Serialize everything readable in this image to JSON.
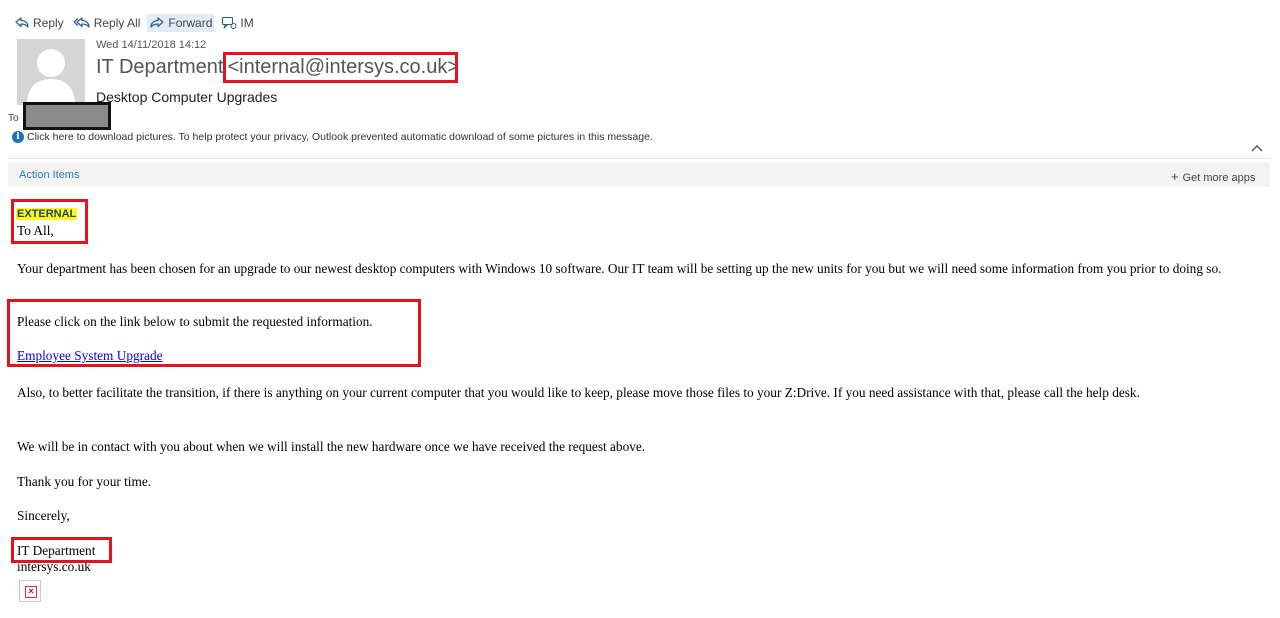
{
  "toolbar": {
    "reply": "Reply",
    "reply_all": "Reply All",
    "forward": "Forward",
    "im": "IM"
  },
  "header": {
    "date": "Wed 14/11/2018 14:12",
    "sender_name": "IT Department",
    "sender_email": "<internal@intersys.co.uk>",
    "subject": "Desktop Computer Upgrades",
    "to_label": "To"
  },
  "info_bar": {
    "text": "Click here to download pictures. To help protect your privacy, Outlook prevented automatic download of some pictures in this message."
  },
  "apps_bar": {
    "action_items": "Action Items",
    "get_more_apps": "Get more apps"
  },
  "body": {
    "external_tag": "EXTERNAL",
    "greeting": "To All,",
    "para1": "Your department has been chosen for an upgrade to our newest desktop computers with Windows 10 software.  Our IT team will be setting up the new units for you but we will need some information from you prior to doing so.",
    "para2": "Please click on the link below to submit the requested information.",
    "link_text": "Employee System Upgrade",
    "para3": "Also, to better facilitate the transition, if there is anything on your current computer that you would like to keep, please move those files to your Z:Drive.  If you need assistance with that, please call the help desk.",
    "para4": "We will be in contact with you about when we will install the new hardware once we have received the request above.",
    "para5": "Thank you for your time.",
    "closing": "Sincerely,",
    "signature_name": "IT Department",
    "signature_domain": "intersys.co.uk"
  },
  "colors": {
    "highlight_box": "#e3141e",
    "link": "#0000ee",
    "external_highlight": "#ffff00",
    "accent": "#2b79c2"
  }
}
